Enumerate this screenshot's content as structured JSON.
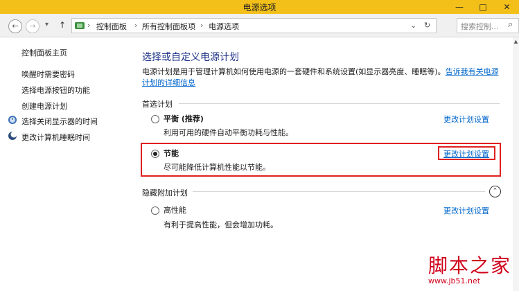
{
  "window": {
    "title": "电源选项",
    "min_glyph": "—",
    "max_glyph": "□",
    "close_glyph": "✕"
  },
  "address_bar": {
    "back_glyph": "←",
    "forward_glyph": "→",
    "recent_glyph": "▾",
    "up_glyph": "↑",
    "breadcrumbs": [
      "控制面板",
      "所有控制面板项",
      "电源选项"
    ],
    "separator": "›",
    "dropdown_glyph": "⌄",
    "refresh_glyph": "↻",
    "search_placeholder": "搜索控制...",
    "search_glyph": "⌕"
  },
  "sidebar": {
    "home": "控制面板主页",
    "items": [
      "唤醒时需要密码",
      "选择电源按钮的功能",
      "创建电源计划",
      "选择关闭显示器的时间",
      "更改计算机睡眠时间"
    ]
  },
  "main": {
    "heading": "选择或自定义电源计划",
    "description": "电源计划是用于管理计算机如何使用电源的一套硬件和系统设置(如显示器亮度、睡眠等)。",
    "description_link": "告诉我有关电源计划的详细信息",
    "preferred_label": "首选计划",
    "hidden_label": "隐藏附加计划",
    "collapse_glyph": "⌃",
    "change_label": "更改计划设置",
    "plans": [
      {
        "name": "平衡",
        "suffix": " (推荐)",
        "desc": "利用可用的硬件自动平衡功耗与性能。",
        "selected": false
      },
      {
        "name": "节能",
        "suffix": "",
        "desc": "尽可能降低计算机性能以节能。",
        "selected": true
      },
      {
        "name": "高性能",
        "suffix": "",
        "desc": "有利于提高性能，但会增加功耗。",
        "selected": false
      }
    ]
  },
  "watermark": {
    "line1": "脚本之家",
    "line2": "www.jb51.net"
  },
  "colors": {
    "titlebar": "#f3c01a",
    "link": "#0066cc",
    "heading": "#1e3287",
    "highlight_box": "#e02020"
  }
}
